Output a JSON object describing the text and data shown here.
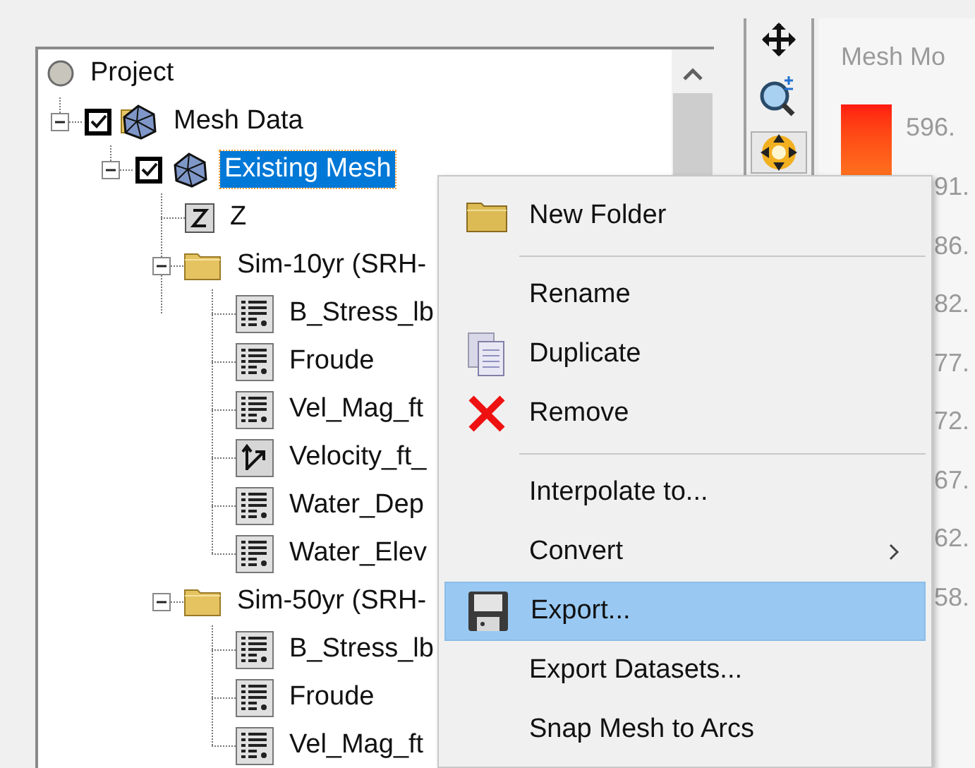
{
  "tree": [
    {
      "label": "Project",
      "kind": "project",
      "selected": false,
      "children": [
        {
          "label": "Mesh Data",
          "kind": "mesh_folder",
          "expanded": true,
          "checked": true,
          "selected": false,
          "children": [
            {
              "label": "Existing Mesh",
              "kind": "mesh",
              "expanded": true,
              "checked": true,
              "selected": true,
              "children": [
                {
                  "label": "Z",
                  "kind": "z",
                  "selected": false
                },
                {
                  "label": "Sim-10yr (SRH-",
                  "kind": "folder",
                  "expanded": true,
                  "selected": false,
                  "children": [
                    {
                      "label": "B_Stress_lb",
                      "kind": "scalar",
                      "selected": false
                    },
                    {
                      "label": "Froude",
                      "kind": "scalar",
                      "selected": false
                    },
                    {
                      "label": "Vel_Mag_ft",
                      "kind": "scalar",
                      "selected": false
                    },
                    {
                      "label": "Velocity_ft_",
                      "kind": "vector",
                      "selected": false
                    },
                    {
                      "label": "Water_Dep",
                      "kind": "scalar",
                      "selected": false
                    },
                    {
                      "label": "Water_Elev",
                      "kind": "scalar",
                      "selected": false
                    }
                  ]
                },
                {
                  "label": "Sim-50yr (SRH-",
                  "kind": "folder",
                  "expanded": true,
                  "selected": false,
                  "children": [
                    {
                      "label": "B_Stress_lb",
                      "kind": "scalar",
                      "selected": false
                    },
                    {
                      "label": "Froude",
                      "kind": "scalar",
                      "selected": false
                    },
                    {
                      "label": "Vel_Mag_ft",
                      "kind": "scalar",
                      "selected": false
                    }
                  ]
                }
              ]
            }
          ]
        }
      ]
    }
  ],
  "toolbar": [
    {
      "kind": "pan",
      "selected": false
    },
    {
      "kind": "zoom",
      "selected": false
    },
    {
      "kind": "rotate",
      "selected": true
    }
  ],
  "legend": {
    "title": "Mesh Mo",
    "top_label": "596.",
    "labels": [
      "91.",
      "86.",
      "82.",
      "77.",
      "72.",
      "67.",
      "62.",
      "58."
    ]
  },
  "context_menu": [
    {
      "kind": "item",
      "label": "New Folder",
      "selected": false
    },
    {
      "kind": "separator"
    },
    {
      "kind": "item",
      "label": "Rename",
      "selected": false
    },
    {
      "kind": "item",
      "label": "Duplicate",
      "selected": false
    },
    {
      "kind": "item",
      "label": "Remove",
      "selected": false
    },
    {
      "kind": "separator"
    },
    {
      "kind": "item",
      "label": "Interpolate to...",
      "selected": false
    },
    {
      "kind": "item",
      "label": "Convert",
      "submenu": true,
      "selected": false
    },
    {
      "kind": "item",
      "label": "Export...",
      "selected": true
    },
    {
      "kind": "item",
      "label": "Export Datasets...",
      "selected": false
    },
    {
      "kind": "item",
      "label": "Snap Mesh to Arcs",
      "selected": false
    }
  ]
}
